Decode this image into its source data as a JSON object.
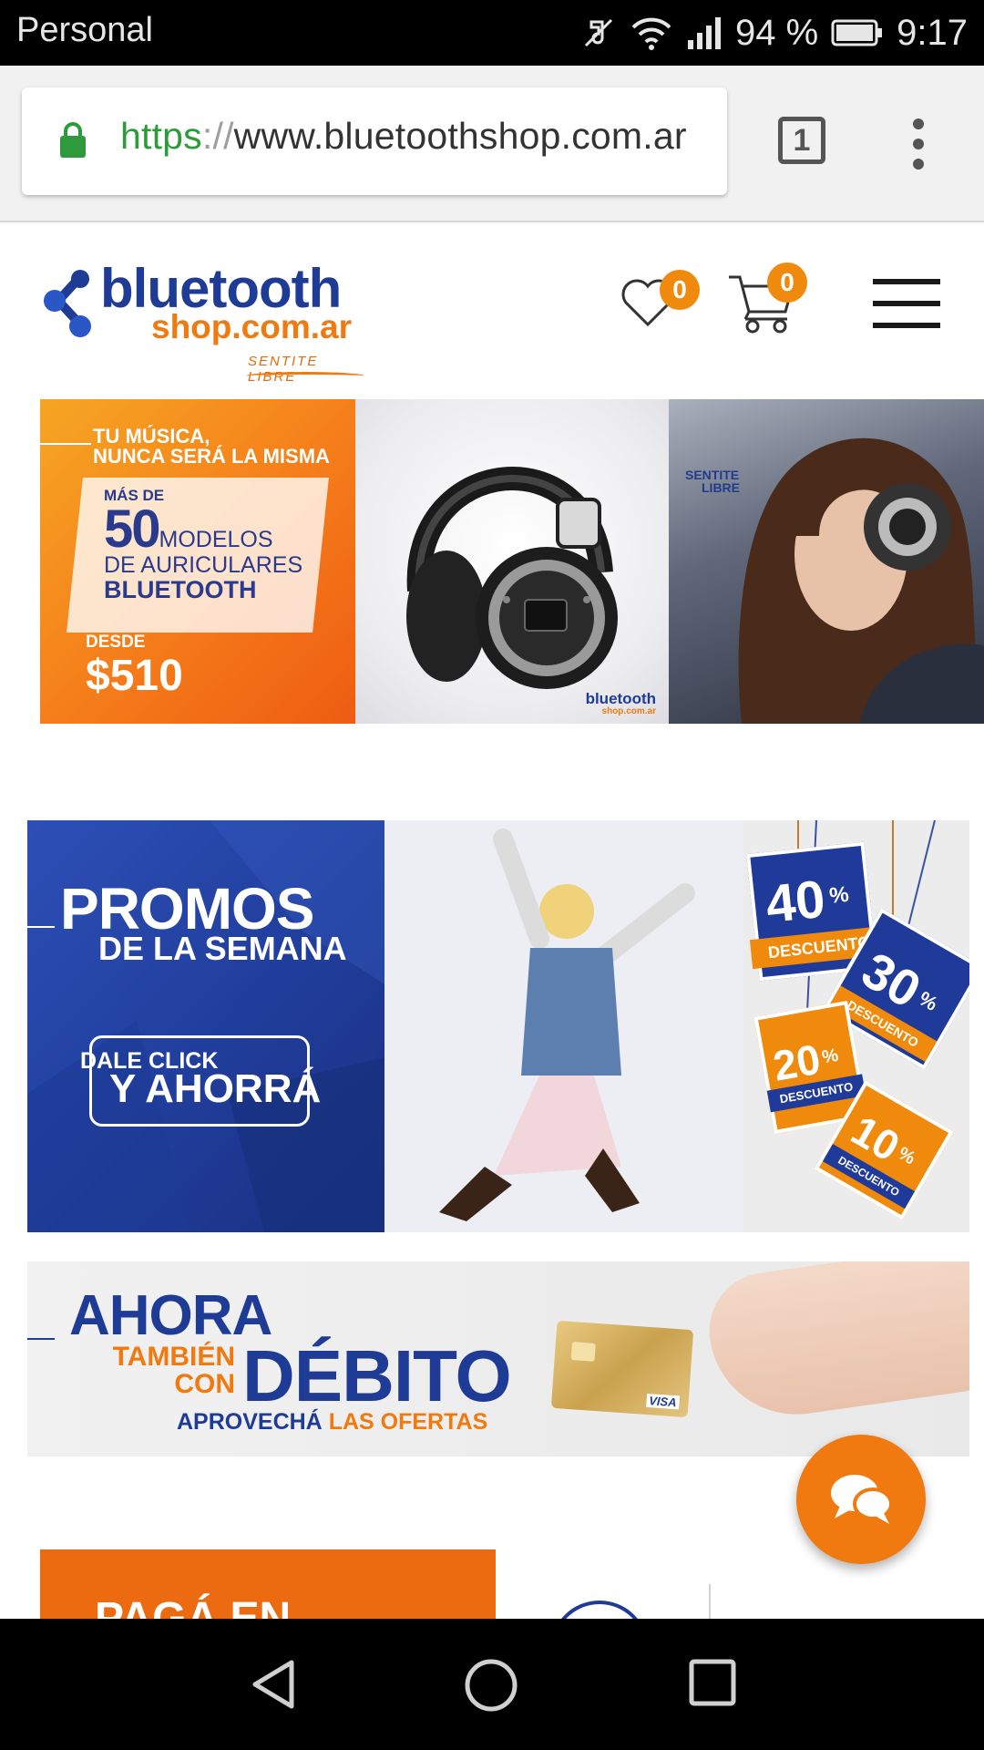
{
  "status_bar": {
    "carrier": "Personal",
    "battery_percent": "94 %",
    "time": "9:17",
    "icons": [
      "mute-icon",
      "wifi-icon",
      "signal-icon",
      "battery-icon"
    ]
  },
  "browser": {
    "url_scheme": "https",
    "url_separator": "://",
    "url_host": "www.bluetoothshop.com.ar",
    "tab_count": "1",
    "secure_color": "#2e9a3c"
  },
  "site": {
    "logo_main": "bluetooth",
    "logo_sub": "shop.com.ar",
    "logo_tagline": "SENTITE LIBRE",
    "wishlist_count": "0",
    "cart_count": "0",
    "brand_blue": "#1e3b96",
    "brand_orange": "#f07a10"
  },
  "banner_headphones": {
    "line1": "TU MÚSICA,",
    "line2": "NUNCA SERÁ LA MISMA",
    "mas_de": "MÁS DE",
    "number": "50",
    "modelos": "MODELOS",
    "de_auriculares": "DE AURICULARES",
    "bluetooth": "BLUETOOTH",
    "desde": "DESDE",
    "price": "$510",
    "mini_logo": "bluetooth",
    "mini_logo_sub": "shop.com.ar",
    "slogan1": "SENTITE",
    "slogan2": "LIBRE"
  },
  "banner_promos": {
    "title1": "PROMOS",
    "title2": "DE LA SEMANA",
    "cta1": "DALE CLICK",
    "cta2": "Y AHORRÁ",
    "tags": [
      {
        "value": "40",
        "unit": "%",
        "label": "DESCUENTO"
      },
      {
        "value": "30",
        "unit": "%",
        "label": "DESCUENTO"
      },
      {
        "value": "20",
        "unit": "%",
        "label": "DESCUENTO"
      },
      {
        "value": "10",
        "unit": "%",
        "label": "DESCUENTO"
      }
    ]
  },
  "banner_debito": {
    "ahora": "AHORA",
    "tambien": "TAMBIÉN",
    "con": "CON",
    "debito": "DÉBITO",
    "aprovecha": "APROVECHÁ",
    "las_ofertas": "LAS OFERTAS",
    "card_brand": "VISA"
  },
  "banner_paga": {
    "text": "PAGÁ EN"
  }
}
